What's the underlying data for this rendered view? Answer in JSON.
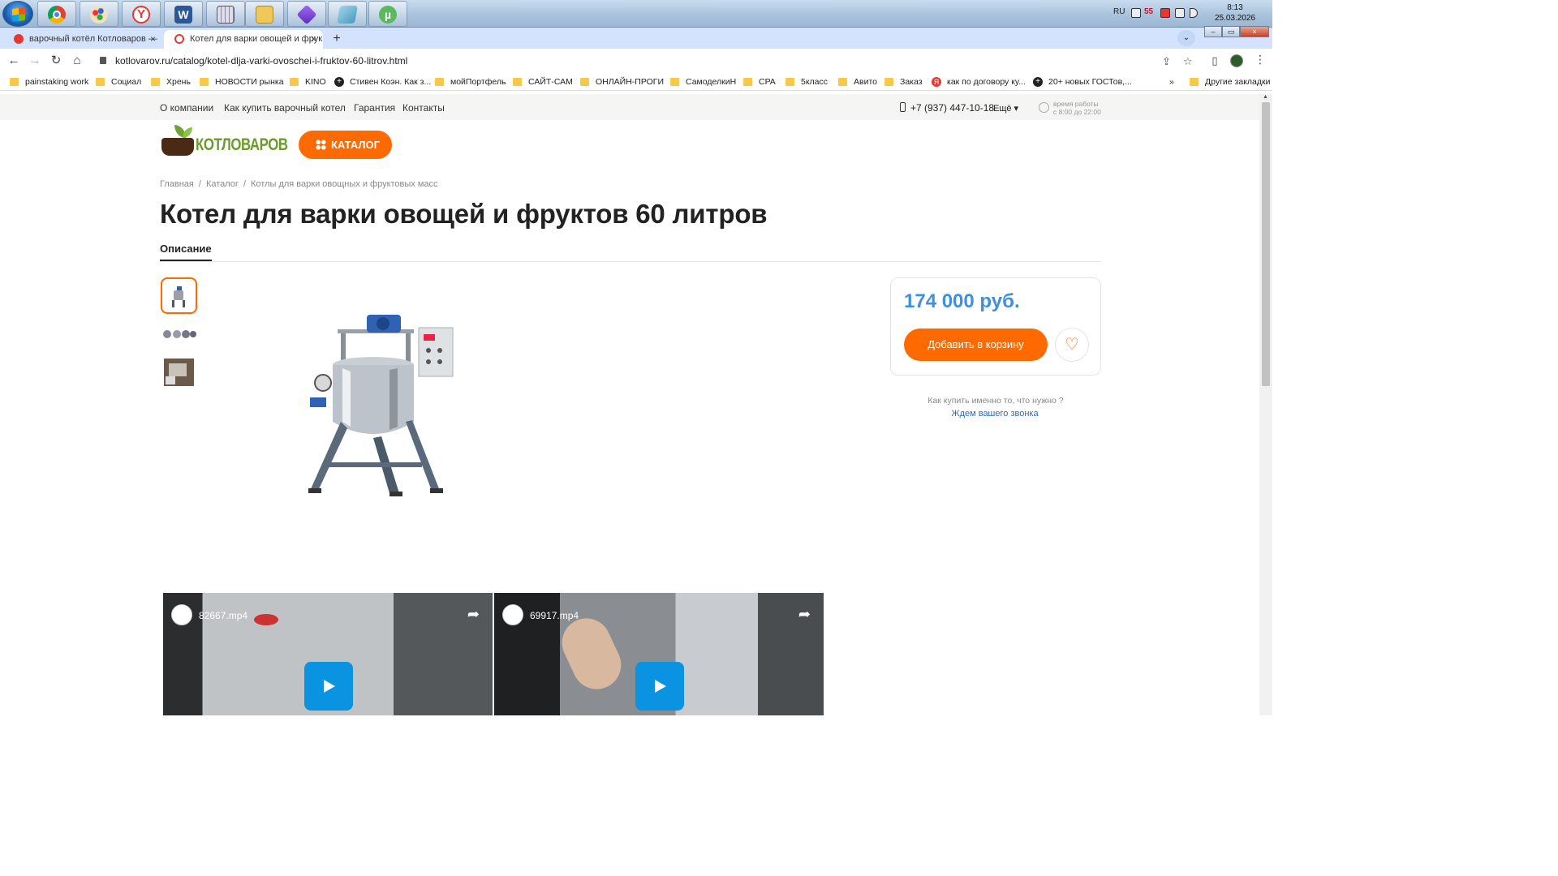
{
  "taskbar": {
    "apps": [
      "windows-explorer-start",
      "chrome",
      "paint",
      "yandex-browser",
      "word",
      "calculator",
      "file-explorer",
      "obsidian",
      "notes",
      "utorrent"
    ],
    "lang": "RU",
    "tray_badge": "55",
    "time": "8:13",
    "date": "25.03.2026"
  },
  "tabs": [
    {
      "title": "варочный котёл Котловаров — ",
      "favicon_color": "#e53935"
    },
    {
      "title": "Котел для варки овощей и фрук",
      "favicon_color": "#e53935"
    }
  ],
  "address": {
    "url": "kotlovarov.ru/catalog/kotel-dlja-varki-ovoschei-i-fruktov-60-litrov.html"
  },
  "bookmarks": [
    {
      "label": "painstaking work",
      "icon": "folder"
    },
    {
      "label": "Социал",
      "icon": "folder"
    },
    {
      "label": "Хрень",
      "icon": "folder"
    },
    {
      "label": "НОВОСТИ рынка",
      "icon": "folder"
    },
    {
      "label": "KINO",
      "icon": "folder"
    },
    {
      "label": "Стивен Коэн. Как з...",
      "icon": "plus"
    },
    {
      "label": "мойПортфель",
      "icon": "folder"
    },
    {
      "label": "САЙТ-САМ",
      "icon": "folder"
    },
    {
      "label": "ОНЛАЙН-ПРОГИ",
      "icon": "folder"
    },
    {
      "label": "СамоделкиН",
      "icon": "folder"
    },
    {
      "label": "CPA",
      "icon": "folder"
    },
    {
      "label": "5класс",
      "icon": "folder"
    },
    {
      "label": "Авито",
      "icon": "folder"
    },
    {
      "label": "Заказ",
      "icon": "folder"
    },
    {
      "label": "как по договору ку...",
      "icon": "yandex"
    },
    {
      "label": "20+ новых ГОСТов,...",
      "icon": "plus"
    },
    {
      "label": "Другие закладки",
      "icon": "folder"
    }
  ],
  "site": {
    "topnav": [
      "О компании",
      "Как купить варочный котел",
      "Гарантия",
      "Контакты"
    ],
    "phone": "+7 (937) 447-10-18",
    "more": "Ещё ▾",
    "worktime_line1": "время работы",
    "worktime_line2": "с 8:00 до 22:00",
    "logo_text": "КОТЛОВАРОВ",
    "catalog_button": "КАТАЛОГ",
    "breadcrumbs": [
      "Главная",
      "Каталог",
      "Котлы для варки овощных и фруктовых масс"
    ],
    "title": "Котел для варки овощей и фруктов 60 литров",
    "desc_tab": "Описание",
    "price": "174 000 руб.",
    "add_to_cart": "Добавить в корзину",
    "how_to_buy": "Как купить именно то, что нужно ?",
    "callback": "Ждем вашего звонка",
    "videos": [
      {
        "title": "82667.mp4"
      },
      {
        "title": "69917.mp4"
      }
    ],
    "colors": {
      "accent": "#ff6a00",
      "price": "#3e8fe0",
      "logo": "#6a9c2c"
    }
  }
}
